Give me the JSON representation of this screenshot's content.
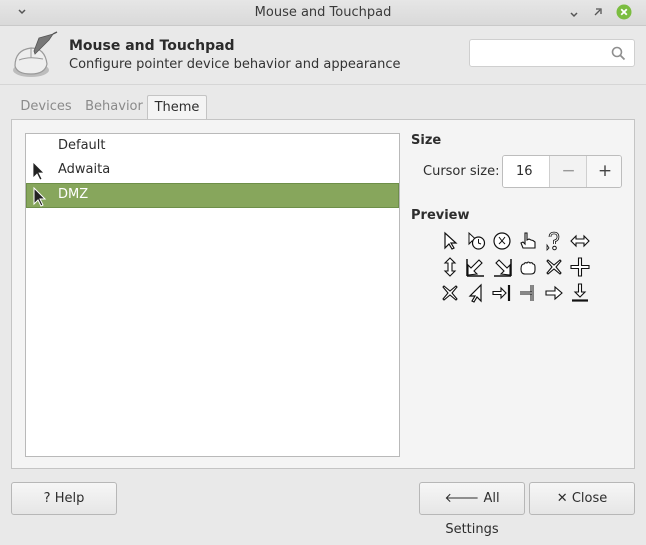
{
  "window": {
    "title": "Mouse and Touchpad"
  },
  "header": {
    "title": "Mouse and Touchpad",
    "subtitle": "Configure pointer device behavior and appearance",
    "search_placeholder": ""
  },
  "tabs": [
    {
      "label": "Devices",
      "active": false
    },
    {
      "label": "Behavior",
      "active": false
    },
    {
      "label": "Theme",
      "active": true
    }
  ],
  "theme_list": [
    {
      "name": "Default",
      "selected": false
    },
    {
      "name": "Adwaita",
      "selected": false
    },
    {
      "name": "DMZ",
      "selected": true
    }
  ],
  "size": {
    "section_title": "Size",
    "label": "Cursor size:",
    "value": "16"
  },
  "preview": {
    "section_title": "Preview"
  },
  "buttons": {
    "help": "Help",
    "all_settings": "All Settings",
    "close": "Close"
  },
  "colors": {
    "selection": "#87a65c",
    "close_button": "#7bbd40",
    "window_bg": "#e9e9e9"
  }
}
